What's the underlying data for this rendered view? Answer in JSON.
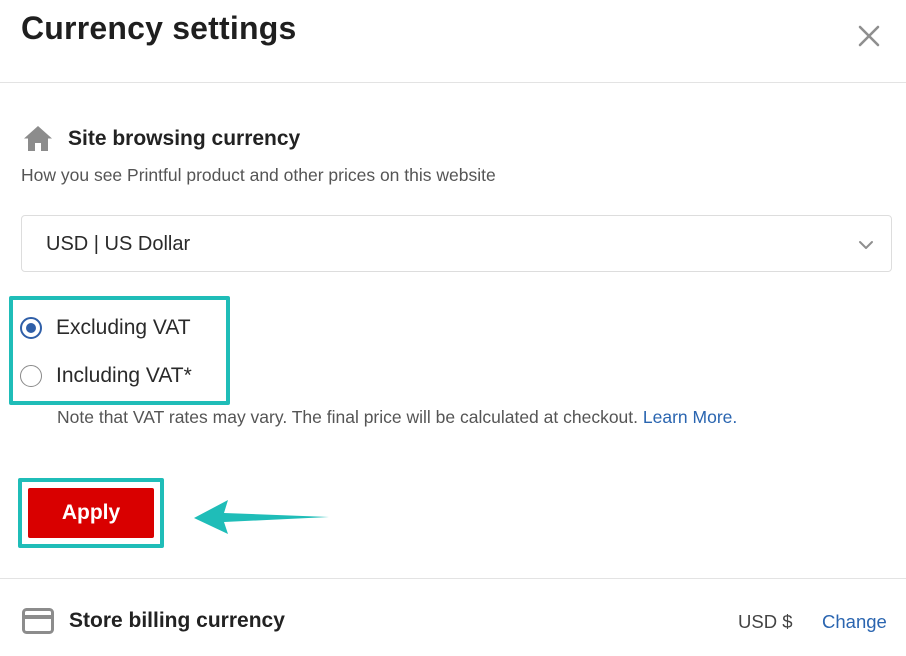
{
  "modal": {
    "title": "Currency settings"
  },
  "site_browsing": {
    "heading": "Site browsing currency",
    "description": "How you see Printful product and other prices on this website",
    "icon": "home-icon",
    "select_value": "USD | US Dollar"
  },
  "vat": {
    "options": [
      {
        "label": "Excluding VAT",
        "checked": true
      },
      {
        "label": "Including VAT*",
        "checked": false
      }
    ],
    "note": "Note that VAT rates may vary. The final price will be calculated at checkout.",
    "learn_more": "Learn More."
  },
  "actions": {
    "apply_label": "Apply"
  },
  "store_billing": {
    "heading": "Store billing currency",
    "icon": "credit-card-icon",
    "value": "USD $",
    "change_label": "Change"
  },
  "colors": {
    "annotation": "#1fbdb8",
    "apply_button": "#d90000",
    "radio_accent": "#2f5fa8",
    "link": "#2a65b0"
  }
}
